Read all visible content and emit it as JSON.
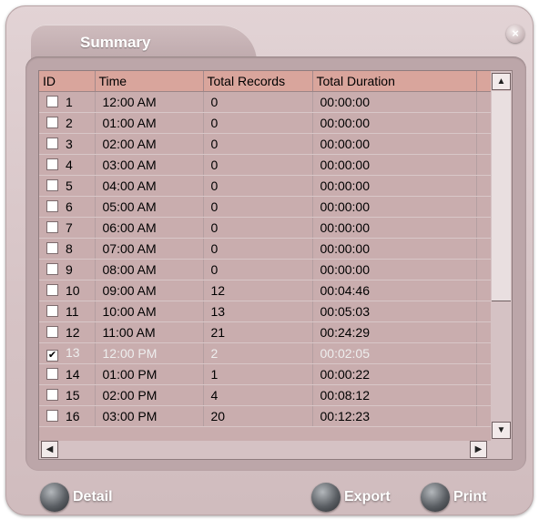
{
  "window": {
    "title": "Summary",
    "close_glyph": "×"
  },
  "table": {
    "columns": [
      "ID",
      "Time",
      "Total Records",
      "Total Duration"
    ],
    "rows": [
      {
        "id": "1",
        "time": "12:00 AM",
        "records": "0",
        "duration": "00:00:00",
        "checked": false
      },
      {
        "id": "2",
        "time": "01:00 AM",
        "records": "0",
        "duration": "00:00:00",
        "checked": false
      },
      {
        "id": "3",
        "time": "02:00 AM",
        "records": "0",
        "duration": "00:00:00",
        "checked": false
      },
      {
        "id": "4",
        "time": "03:00 AM",
        "records": "0",
        "duration": "00:00:00",
        "checked": false
      },
      {
        "id": "5",
        "time": "04:00 AM",
        "records": "0",
        "duration": "00:00:00",
        "checked": false
      },
      {
        "id": "6",
        "time": "05:00 AM",
        "records": "0",
        "duration": "00:00:00",
        "checked": false
      },
      {
        "id": "7",
        "time": "06:00 AM",
        "records": "0",
        "duration": "00:00:00",
        "checked": false
      },
      {
        "id": "8",
        "time": "07:00 AM",
        "records": "0",
        "duration": "00:00:00",
        "checked": false
      },
      {
        "id": "9",
        "time": "08:00 AM",
        "records": "0",
        "duration": "00:00:00",
        "checked": false
      },
      {
        "id": "10",
        "time": "09:00 AM",
        "records": "12",
        "duration": "00:04:46",
        "checked": false
      },
      {
        "id": "11",
        "time": "10:00 AM",
        "records": "13",
        "duration": "00:05:03",
        "checked": false
      },
      {
        "id": "12",
        "time": "11:00 AM",
        "records": "21",
        "duration": "00:24:29",
        "checked": false
      },
      {
        "id": "13",
        "time": "12:00 PM",
        "records": "2",
        "duration": "00:02:05",
        "checked": true
      },
      {
        "id": "14",
        "time": "01:00 PM",
        "records": "1",
        "duration": "00:00:22",
        "checked": false
      },
      {
        "id": "15",
        "time": "02:00 PM",
        "records": "4",
        "duration": "00:08:12",
        "checked": false
      },
      {
        "id": "16",
        "time": "03:00 PM",
        "records": "20",
        "duration": "00:12:23",
        "checked": false
      }
    ]
  },
  "scrollbar": {
    "up": "▲",
    "down": "▼",
    "left": "◀",
    "right": "▶"
  },
  "actions": {
    "detail": "Detail",
    "export": "Export",
    "print": "Print"
  },
  "colors": {
    "header": "#d9a59c",
    "row": "#c9adae",
    "panel": "#bca6a9",
    "window": "#d6c3c5"
  }
}
